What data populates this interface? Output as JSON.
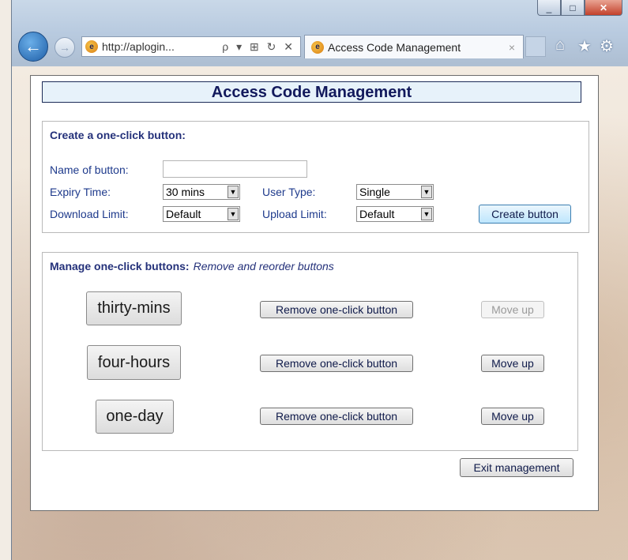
{
  "browser": {
    "address_url": "http://aplogin...",
    "address_tools": "ρ ▾ ⊞ ↻ ✕",
    "tab_title": "Access Code Management",
    "tab_close": "×",
    "window_controls": {
      "minimize": "_",
      "maximize": "□",
      "close": "✕"
    },
    "nav": {
      "back": "←",
      "forward": "→"
    },
    "right_icons": {
      "home": "⌂",
      "favorites": "★",
      "settings": "⚙"
    }
  },
  "page": {
    "title": "Access Code Management",
    "create_section": {
      "heading": "Create a one-click button:",
      "name_label": "Name of button:",
      "name_value": "",
      "expiry_label": "Expiry Time:",
      "expiry_value": "30 mins",
      "user_type_label": "User Type:",
      "user_type_value": "Single",
      "download_label": "Download Limit:",
      "download_value": "Default",
      "upload_label": "Upload Limit:",
      "upload_value": "Default",
      "create_button": "Create button"
    },
    "manage_section": {
      "heading": "Manage one-click buttons:",
      "subheading": "Remove and reorder buttons",
      "rows": [
        {
          "name": "thirty-mins",
          "remove": "Remove one-click button",
          "move": "Move up",
          "move_enabled": false
        },
        {
          "name": "four-hours",
          "remove": "Remove one-click button",
          "move": "Move up",
          "move_enabled": true
        },
        {
          "name": "one-day",
          "remove": "Remove one-click button",
          "move": "Move up",
          "move_enabled": true
        }
      ]
    },
    "exit_button": "Exit management"
  },
  "colors": {
    "title_text": "#12195c",
    "label_text": "#1e3a8c",
    "title_bg": "#e7f2fa"
  }
}
